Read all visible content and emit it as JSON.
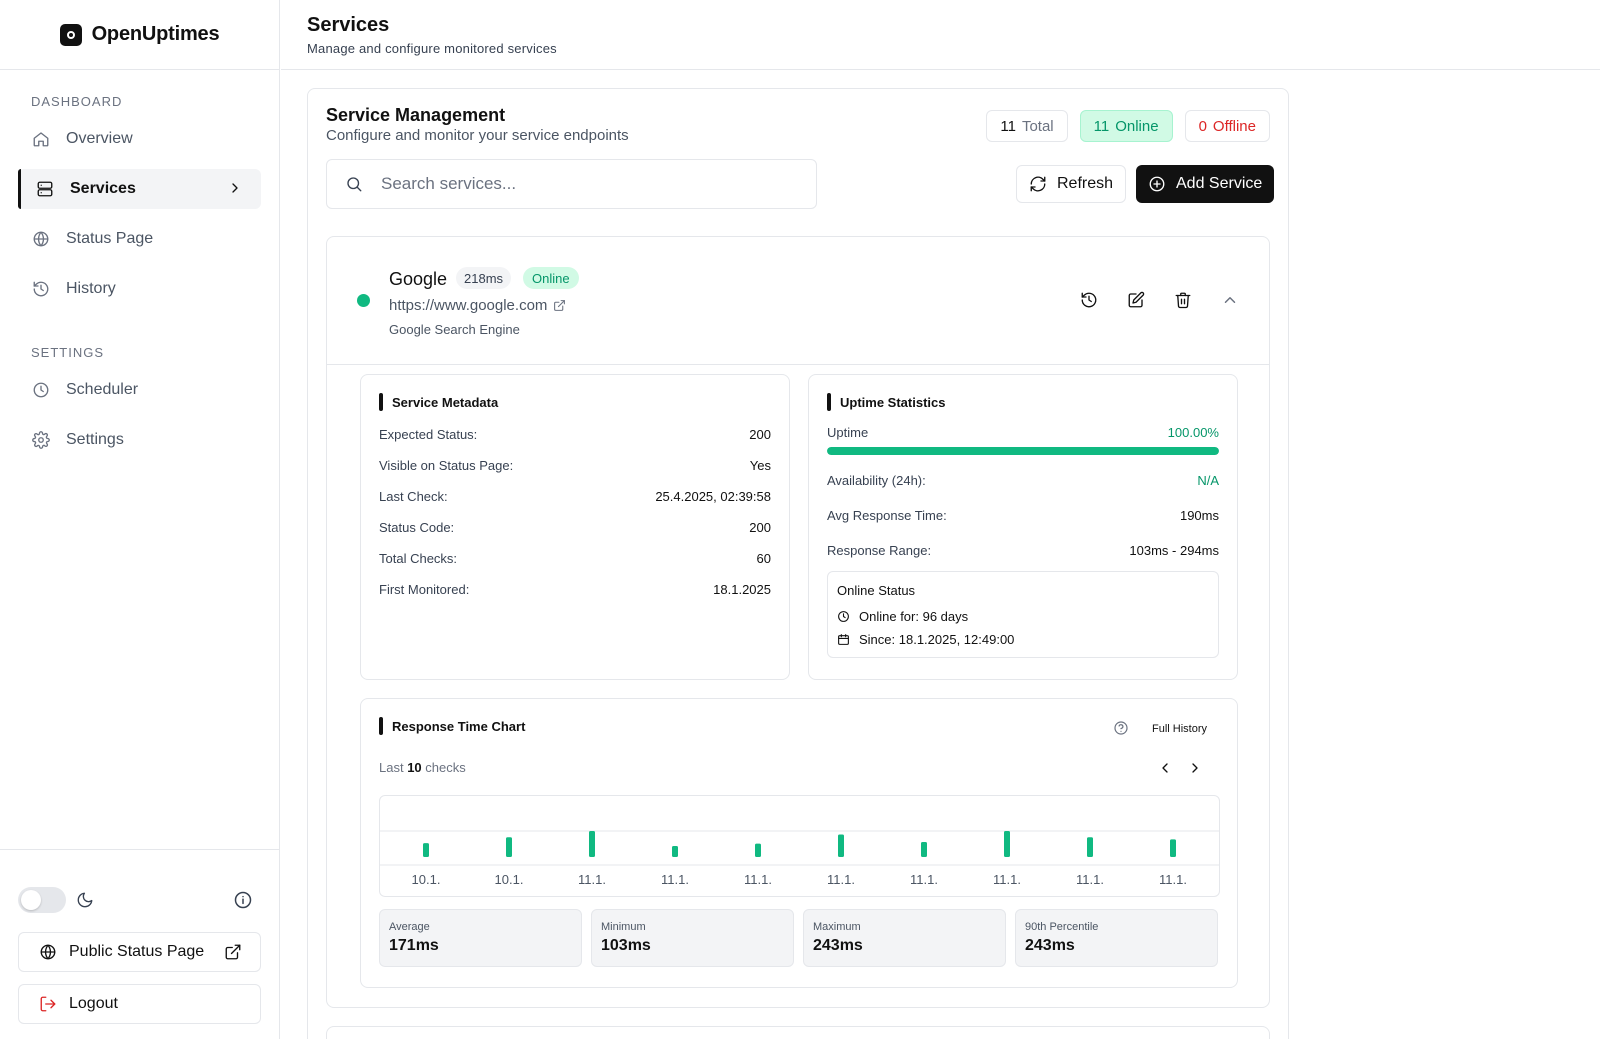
{
  "app": {
    "name": "OpenUptimes"
  },
  "sidebar": {
    "sections": [
      {
        "label": "DASHBOARD"
      },
      {
        "label": "SETTINGS"
      }
    ],
    "items": [
      {
        "label": "Overview",
        "icon": "home-icon"
      },
      {
        "label": "Services",
        "icon": "server-icon"
      },
      {
        "label": "Status Page",
        "icon": "globe-icon"
      },
      {
        "label": "History",
        "icon": "history-icon"
      },
      {
        "label": "Scheduler",
        "icon": "clock-icon"
      },
      {
        "label": "Settings",
        "icon": "gear-icon"
      }
    ],
    "public_status_label": "Public Status Page",
    "logout_label": "Logout"
  },
  "header": {
    "title": "Services",
    "subtitle": "Manage and configure monitored services"
  },
  "management": {
    "title": "Service Management",
    "subtitle": "Configure and monitor your service endpoints",
    "counts": {
      "total_value": "11",
      "total_label": "Total",
      "online_value": "11",
      "online_label": "Online",
      "offline_value": "0",
      "offline_label": "Offline"
    },
    "search_placeholder": "Search services...",
    "refresh_label": "Refresh",
    "add_label": "Add Service"
  },
  "service": {
    "name": "Google",
    "response_ms": "218ms",
    "status": "Online",
    "url": "https://www.google.com",
    "description": "Google Search Engine",
    "metadata": {
      "title": "Service Metadata",
      "rows": [
        {
          "k": "Expected Status:",
          "v": "200"
        },
        {
          "k": "Visible on Status Page:",
          "v": "Yes"
        },
        {
          "k": "Last Check:",
          "v": "25.4.2025, 02:39:58"
        },
        {
          "k": "Status Code:",
          "v": "200"
        },
        {
          "k": "Total Checks:",
          "v": "60"
        },
        {
          "k": "First Monitored:",
          "v": "18.1.2025"
        }
      ]
    },
    "uptime": {
      "title": "Uptime Statistics",
      "uptime_label": "Uptime",
      "uptime_value": "100.00%",
      "uptime_fraction": 1.0,
      "rows": [
        {
          "k": "Availability (24h):",
          "v": "N/A"
        },
        {
          "k": "Avg Response Time:",
          "v": "190ms"
        },
        {
          "k": "Response Range:",
          "v": "103ms - 294ms"
        }
      ],
      "online_status": {
        "title": "Online Status",
        "online_for": "Online for: 96 days",
        "since": "Since: 18.1.2025, 12:49:00"
      }
    },
    "chart": {
      "title": "Response Time Chart",
      "full_history_label": "Full History",
      "last_prefix": "Last",
      "last_count": "10",
      "last_suffix": "checks",
      "stats": [
        {
          "k": "Average",
          "v": "171ms"
        },
        {
          "k": "Minimum",
          "v": "103ms"
        },
        {
          "k": "Maximum",
          "v": "243ms"
        },
        {
          "k": "90th Percentile",
          "v": "243ms"
        }
      ]
    }
  },
  "chart_data": {
    "type": "bar",
    "categories": [
      "10.1.",
      "10.1.",
      "11.1.",
      "11.1.",
      "11.1.",
      "11.1.",
      "11.1.",
      "11.1.",
      "11.1.",
      "11.1."
    ],
    "values": [
      130,
      185,
      243,
      103,
      125,
      210,
      140,
      243,
      185,
      165
    ],
    "ylim": [
      0,
      243
    ],
    "color": "#10b981",
    "grid": false
  },
  "colors": {
    "accent": "#10b981",
    "danger": "#dc2626",
    "dark": "#111111"
  }
}
